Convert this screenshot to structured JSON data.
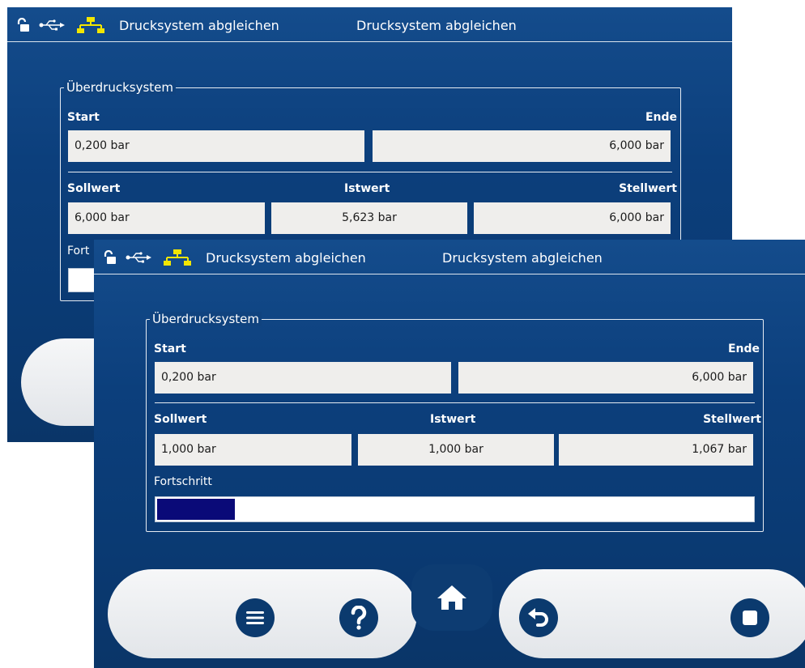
{
  "back_screen": {
    "status": {
      "left_title": "Drucksystem abgleichen",
      "center_title": "Drucksystem abgleichen",
      "icons": [
        "unlocked-padlock-icon",
        "usb-icon",
        "network-icon"
      ]
    },
    "group": {
      "legend": "Überdrucksystem",
      "start_label": "Start",
      "end_label": "Ende",
      "start_value": "0,200 bar",
      "end_value": "6,000 bar",
      "setpoint_label": "Sollwert",
      "actual_label": "Istwert",
      "output_label": "Stellwert",
      "setpoint_value": "6,000 bar",
      "actual_value": "5,623 bar",
      "output_value": "6,000 bar",
      "progress_label_partial": "Fort"
    }
  },
  "front_screen": {
    "status": {
      "left_title": "Drucksystem abgleichen",
      "center_title": "Drucksystem abgleichen",
      "icons": [
        "unlocked-padlock-icon",
        "usb-icon",
        "network-icon"
      ]
    },
    "group": {
      "legend": "Überdrucksystem",
      "start_label": "Start",
      "end_label": "Ende",
      "start_value": "0,200 bar",
      "end_value": "6,000 bar",
      "setpoint_label": "Sollwert",
      "actual_label": "Istwert",
      "output_label": "Stellwert",
      "setpoint_value": "1,000 bar",
      "actual_value": "1,000 bar",
      "output_value": "1,067 bar",
      "progress_label": "Fortschritt",
      "progress_fraction": 0.13
    },
    "toolbar": {
      "buttons": [
        "menu-icon",
        "help-icon",
        "home-icon",
        "undo-icon",
        "stop-icon"
      ]
    }
  },
  "colors": {
    "screen_bg": "#0c3f7c",
    "field_bg": "#efeeec",
    "progress_fill": "#0a0a78",
    "network_icon": "#f2e600",
    "button_fill": "#0b3a6e",
    "toolbar_bg": "#eceef1"
  }
}
